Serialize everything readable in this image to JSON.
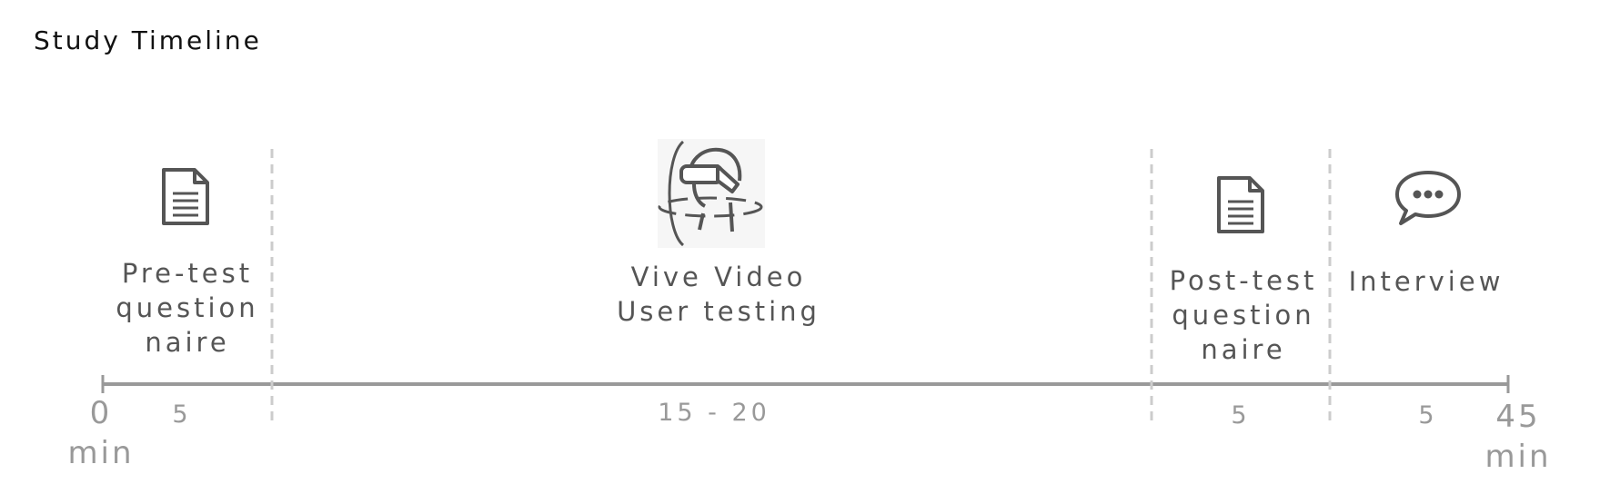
{
  "title": "Study Timeline",
  "phases": [
    {
      "label_lines": [
        "Pre-test",
        "question",
        "naire"
      ],
      "duration": "5",
      "icon": "document-icon"
    },
    {
      "label_lines": [
        "Vive Video",
        "User testing"
      ],
      "duration": "15 - 20",
      "icon": "vr-headset-icon"
    },
    {
      "label_lines": [
        "Post-test",
        "question",
        "naire"
      ],
      "duration": "5",
      "icon": "document-icon"
    },
    {
      "label_lines": [
        "Interview"
      ],
      "duration": "5",
      "icon": "speech-bubble-icon"
    }
  ],
  "axis": {
    "start_value": "0",
    "start_unit": "min",
    "end_value": "45",
    "end_unit": "min"
  },
  "colors": {
    "axis": "#999999",
    "divider": "#cccccc",
    "icon": "#555555",
    "label": "#555555"
  }
}
